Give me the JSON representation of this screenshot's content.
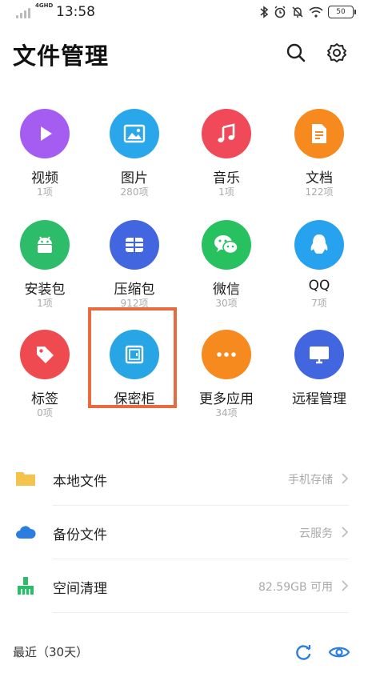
{
  "status_bar": {
    "network": "4GHD",
    "time": "13:58",
    "battery": "50",
    "icons": [
      "bluetooth-icon",
      "alarm-icon",
      "mute-icon",
      "wifi-icon",
      "battery-icon"
    ]
  },
  "header": {
    "title": "文件管理",
    "icons": [
      "search-icon",
      "settings-icon"
    ]
  },
  "categories": [
    {
      "label": "视频",
      "count": "1项",
      "icon": "play-icon",
      "color": "#a55cf0"
    },
    {
      "label": "图片",
      "count": "280项",
      "icon": "image-icon",
      "color": "#2aa7ea"
    },
    {
      "label": "音乐",
      "count": "1项",
      "icon": "music-note-icon",
      "color": "#f04a5a"
    },
    {
      "label": "文档",
      "count": "122项",
      "icon": "document-icon",
      "color": "#f68a1f"
    },
    {
      "label": "安装包",
      "count": "1项",
      "icon": "android-icon",
      "color": "#2cbc6a"
    },
    {
      "label": "压缩包",
      "count": "912项",
      "icon": "archive-icon",
      "color": "#4166df"
    },
    {
      "label": "微信",
      "count": "30项",
      "icon": "wechat-icon",
      "color": "#27c160"
    },
    {
      "label": "QQ",
      "count": "7项",
      "icon": "qq-penguin-icon",
      "color": "#27a2ee"
    },
    {
      "label": "标签",
      "count": "0项",
      "icon": "tag-icon",
      "color": "#ef4a4f"
    },
    {
      "label": "保密柜",
      "count": "",
      "icon": "safe-icon",
      "color": "#28a5e4"
    },
    {
      "label": "更多应用",
      "count": "34项",
      "icon": "more-icon",
      "color": "#f68a1f"
    },
    {
      "label": "远程管理",
      "count": "",
      "icon": "monitor-icon",
      "color": "#4166df"
    }
  ],
  "storage_list": [
    {
      "label": "本地文件",
      "meta": "手机存储",
      "icon": "folder-icon",
      "color": "#f4c34b"
    },
    {
      "label": "备份文件",
      "meta": "云服务",
      "icon": "cloud-icon",
      "color": "#2b7de0"
    },
    {
      "label": "空间清理",
      "meta": "82.59GB 可用",
      "icon": "broom-icon",
      "color": "#2cbc6a"
    }
  ],
  "recent": {
    "label": "最近（30天）",
    "icons": [
      "refresh-icon",
      "eye-icon"
    ],
    "accent": "#2b7de0"
  }
}
